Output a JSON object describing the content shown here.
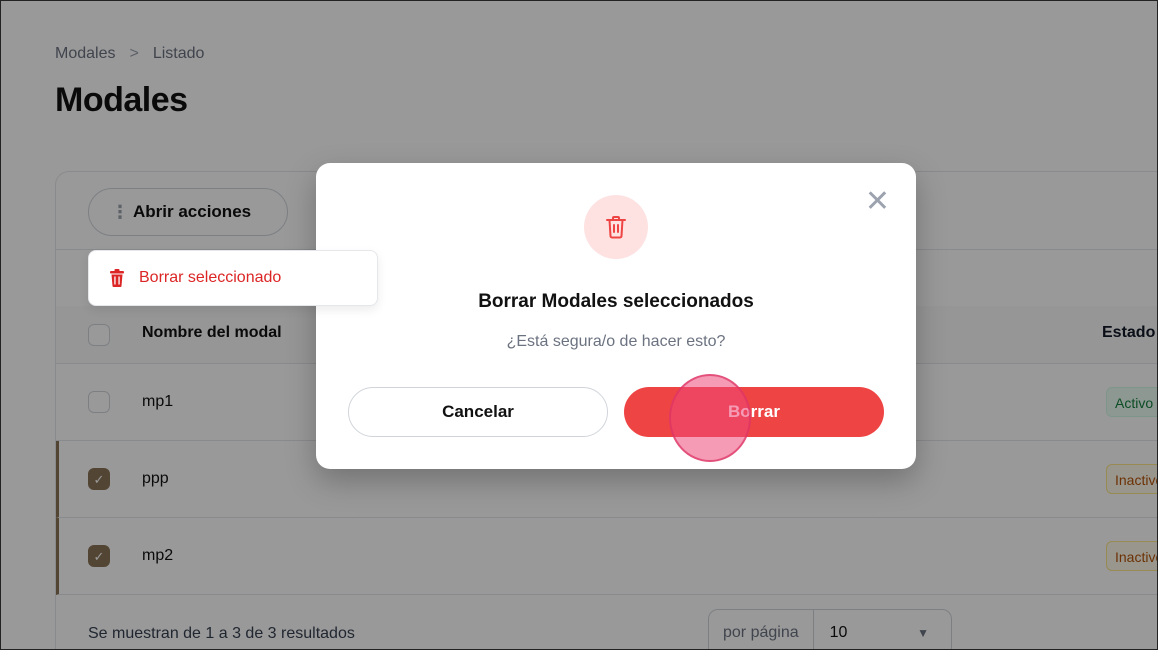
{
  "breadcrumb": {
    "root": "Modales",
    "separator": ">",
    "current": "Listado"
  },
  "page_title": "Modales",
  "toolbar": {
    "actions_label": "Abrir acciones",
    "dropdown_item": "Borrar seleccionado"
  },
  "table": {
    "header": {
      "name": "Nombre del modal",
      "status": "Estado"
    },
    "rows": [
      {
        "name": "mp1",
        "checked": false,
        "status": "Activo",
        "status_color": "green"
      },
      {
        "name": "ppp",
        "checked": true,
        "status": "Inactivo",
        "status_color": "amber"
      },
      {
        "name": "mp2",
        "checked": true,
        "status": "Inactivo",
        "status_color": "amber"
      }
    ]
  },
  "footer": {
    "results_text": "Se muestran de 1 a 3 de 3 resultados",
    "per_page_label": "por página",
    "per_page_value": "10"
  },
  "modal": {
    "title": "Borrar Modales seleccionados",
    "description": "¿Está segura/o de hacer esto?",
    "cancel_label": "Cancelar",
    "confirm_label": "Borrar"
  },
  "colors": {
    "accent": "#8b7455",
    "danger": "#ef4444",
    "danger_soft": "#fee2e2"
  },
  "checkmark": "✓"
}
